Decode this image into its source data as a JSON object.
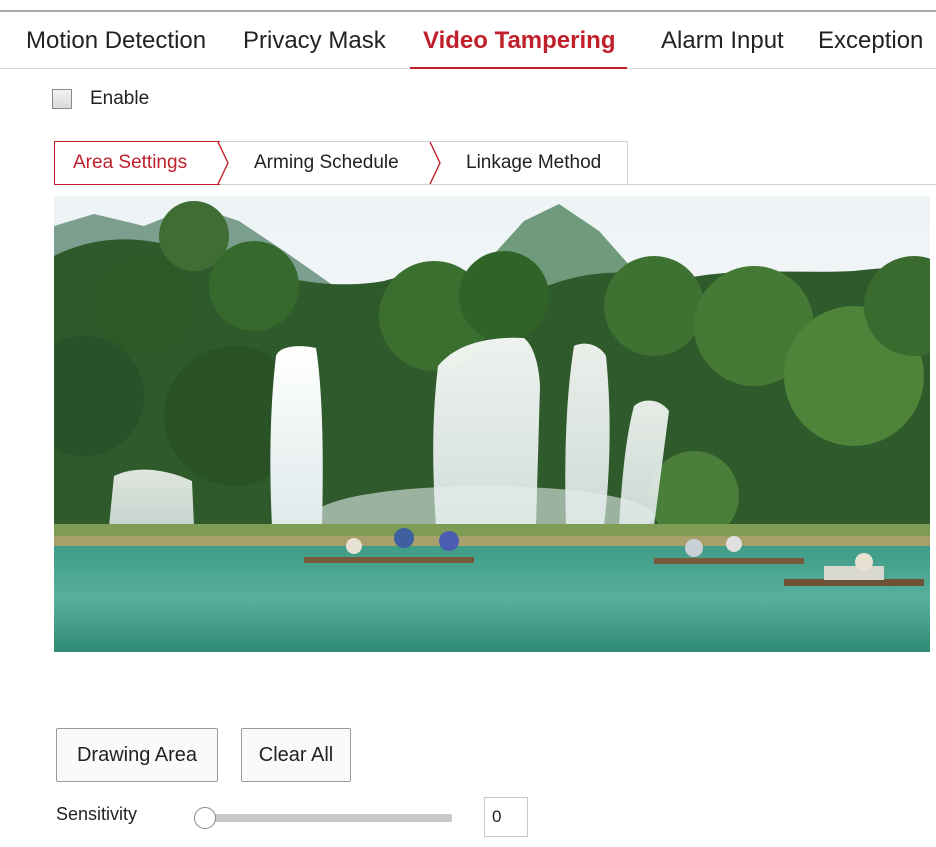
{
  "tabs": [
    {
      "label": "Motion Detection"
    },
    {
      "label": "Privacy Mask"
    },
    {
      "label": "Video Tampering",
      "active": true
    },
    {
      "label": "Alarm Input"
    },
    {
      "label": "Exception"
    }
  ],
  "enable": {
    "label": "Enable",
    "checked": false
  },
  "subtabs": [
    {
      "label": "Area Settings",
      "active": true
    },
    {
      "label": "Arming Schedule"
    },
    {
      "label": "Linkage Method"
    }
  ],
  "video": {
    "icon": "live-view-image"
  },
  "buttons": {
    "drawing_area": "Drawing Area",
    "clear_all": "Clear All"
  },
  "sensitivity": {
    "label": "Sensitivity",
    "value": "0",
    "level": 0
  },
  "colors": {
    "accent": "#c0202c",
    "border": "#cfcfcf"
  }
}
